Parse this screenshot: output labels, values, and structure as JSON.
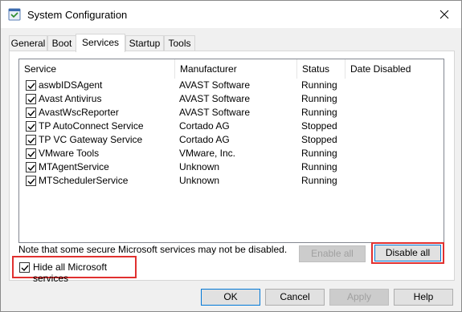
{
  "window": {
    "title": "System Configuration"
  },
  "tabs": [
    {
      "label": "General",
      "active": false
    },
    {
      "label": "Boot",
      "active": false
    },
    {
      "label": "Services",
      "active": true
    },
    {
      "label": "Startup",
      "active": false
    },
    {
      "label": "Tools",
      "active": false
    }
  ],
  "table": {
    "columns": [
      "Service",
      "Manufacturer",
      "Status",
      "Date Disabled"
    ],
    "rows": [
      {
        "service": "aswbIDSAgent",
        "manufacturer": "AVAST Software",
        "status": "Running",
        "date_disabled": "",
        "checked": true
      },
      {
        "service": "Avast Antivirus",
        "manufacturer": "AVAST Software",
        "status": "Running",
        "date_disabled": "",
        "checked": true
      },
      {
        "service": "AvastWscReporter",
        "manufacturer": "AVAST Software",
        "status": "Running",
        "date_disabled": "",
        "checked": true
      },
      {
        "service": "TP AutoConnect Service",
        "manufacturer": "Cortado AG",
        "status": "Stopped",
        "date_disabled": "",
        "checked": true
      },
      {
        "service": "TP VC Gateway Service",
        "manufacturer": "Cortado AG",
        "status": "Stopped",
        "date_disabled": "",
        "checked": true
      },
      {
        "service": "VMware Tools",
        "manufacturer": "VMware, Inc.",
        "status": "Running",
        "date_disabled": "",
        "checked": true
      },
      {
        "service": "MTAgentService",
        "manufacturer": "Unknown",
        "status": "Running",
        "date_disabled": "",
        "checked": true
      },
      {
        "service": "MTSchedulerService",
        "manufacturer": "Unknown",
        "status": "Running",
        "date_disabled": "",
        "checked": true
      }
    ]
  },
  "note": "Note that some secure Microsoft services may not be disabled.",
  "buttons": {
    "enable_all": "Enable all",
    "disable_all": "Disable all",
    "ok": "OK",
    "cancel": "Cancel",
    "apply": "Apply",
    "help": "Help"
  },
  "hide_ms": {
    "label": "Hide all Microsoft services",
    "checked": true
  },
  "colors": {
    "highlight": "#e0302f",
    "focus": "#0078d7"
  }
}
